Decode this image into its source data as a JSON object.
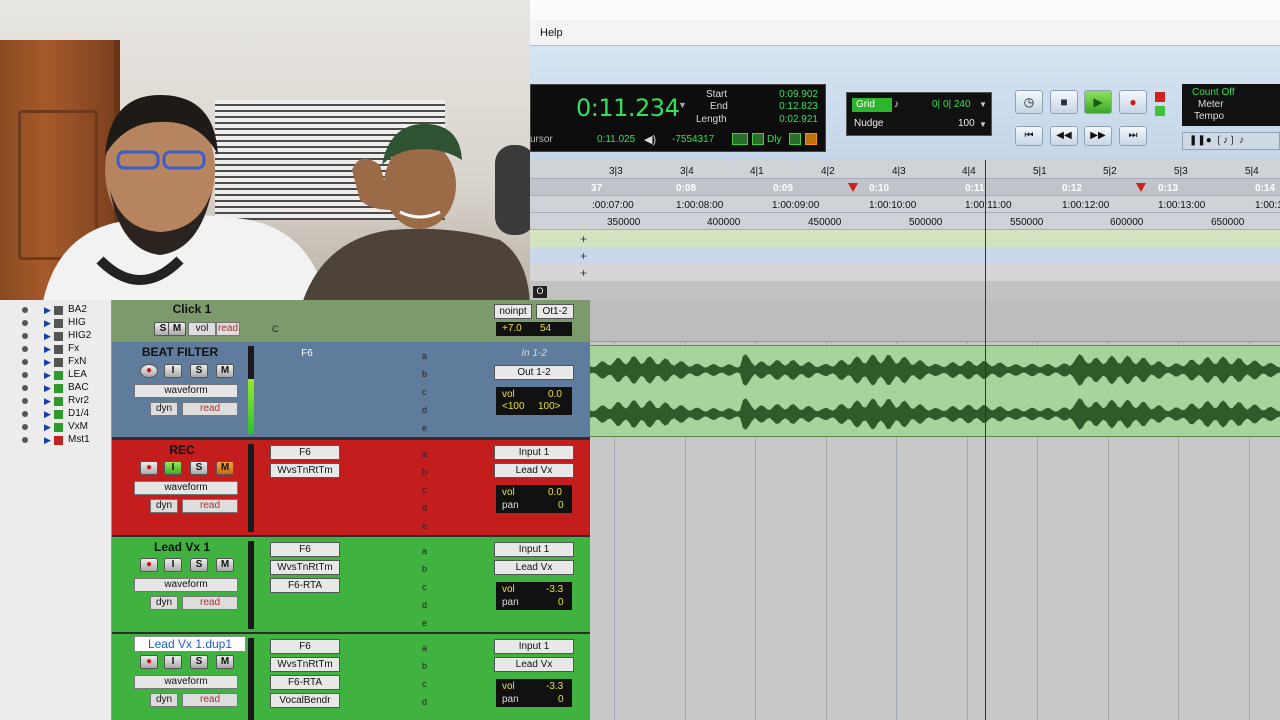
{
  "menu": {
    "help": "Help"
  },
  "counter": {
    "main": "0:11.234",
    "cursor_label": "ursor",
    "cursor_value": "0:11.025",
    "neg_value": "-7554317",
    "start_label": "Start",
    "end_label": "End",
    "length_label": "Length",
    "start": "0:09.902",
    "end": "0:12.823",
    "length": "0:02.921",
    "dly_label": "Dly"
  },
  "grid": {
    "label": "Grid",
    "value": "0| 0| 240",
    "nudge_label": "Nudge",
    "nudge_value": "100"
  },
  "meter_box": {
    "count_off": "Count Off",
    "meter": "Meter",
    "tempo": "Tempo"
  },
  "ruler": {
    "bars": [
      "3|3",
      "3|4",
      "4|1",
      "4|2",
      "4|3",
      "4|4",
      "5|1",
      "5|2",
      "5|3",
      "5|4"
    ],
    "seconds": [
      "37",
      "0:08",
      "0:09",
      "0:10",
      "0:11",
      "0:12",
      "0:13",
      "0:14"
    ],
    "timecode": [
      ":00:07:00",
      "1:00:08:00",
      "1:00:09:00",
      "1:00:10:00",
      "1:00:11:00",
      "1:00:12:00",
      "1:00:13:00",
      "1:00:1"
    ],
    "samples": [
      "350000",
      "400000",
      "450000",
      "500000",
      "550000",
      "600000",
      "650000"
    ],
    "o_label": "O"
  },
  "tracklist": [
    {
      "name": "BA2",
      "color": "#555555"
    },
    {
      "name": "HIG",
      "color": "#555555"
    },
    {
      "name": "HIG2",
      "color": "#555555"
    },
    {
      "name": "Fx",
      "color": "#555555"
    },
    {
      "name": "FxN",
      "color": "#555555"
    },
    {
      "name": "LEA",
      "color": "#2e9a2e"
    },
    {
      "name": "BAC",
      "color": "#2e9a2e"
    },
    {
      "name": "Rvr2",
      "color": "#2e9a2e"
    },
    {
      "name": "D1/4",
      "color": "#2e9a2e"
    },
    {
      "name": "VxM",
      "color": "#2e9a2e"
    },
    {
      "name": "Mst1",
      "color": "#c02020"
    }
  ],
  "tracks": {
    "click": {
      "name": "Click 1",
      "s": "S",
      "m": "M",
      "vol": "vol",
      "read": "read",
      "c": "C",
      "io1": "noinpt",
      "io2": "Ot1-2",
      "v1": "+7.0",
      "v2": "54"
    },
    "beat": {
      "name": "BEAT FILTER",
      "insert": "F6",
      "io1": "In 1-2",
      "io2": "Out 1-2",
      "vol_label": "vol",
      "vol": "0.0",
      "pan_l": "<100",
      "pan_r": "100>",
      "wf": "waveform",
      "dyn": "dyn",
      "read": "read"
    },
    "rec": {
      "name": "REC",
      "insert1": "F6",
      "insert2": "WvsTnRtTm",
      "io1": "Input 1",
      "io2": "Lead Vx",
      "vol_label": "vol",
      "vol": "0.0",
      "pan_label": "pan",
      "pan": "0",
      "wf": "waveform",
      "dyn": "dyn",
      "read": "read"
    },
    "lead": {
      "name": "Lead Vx 1",
      "insert1": "F6",
      "insert2": "WvsTnRtTm",
      "insert3": "F6-RTA",
      "io1": "Input 1",
      "io2": "Lead Vx",
      "vol_label": "vol",
      "vol": "-3.3",
      "pan_label": "pan",
      "pan": "0",
      "wf": "waveform",
      "dyn": "dyn",
      "read": "read"
    },
    "dup": {
      "name": "Lead Vx 1.dup1",
      "insert1": "F6",
      "insert2": "WvsTnRtTm",
      "insert3": "F6-RTA",
      "insert4": "VocalBendr",
      "io1": "Input 1",
      "io2": "Lead Vx",
      "vol_label": "vol",
      "vol": "-3.3",
      "pan_label": "pan",
      "pan": "0",
      "wf": "waveform",
      "dyn": "dyn",
      "read": "read"
    }
  },
  "btn_labels": {
    "i": "I",
    "s": "S",
    "m": "M"
  },
  "slots": [
    "a",
    "b",
    "c",
    "d",
    "e"
  ]
}
